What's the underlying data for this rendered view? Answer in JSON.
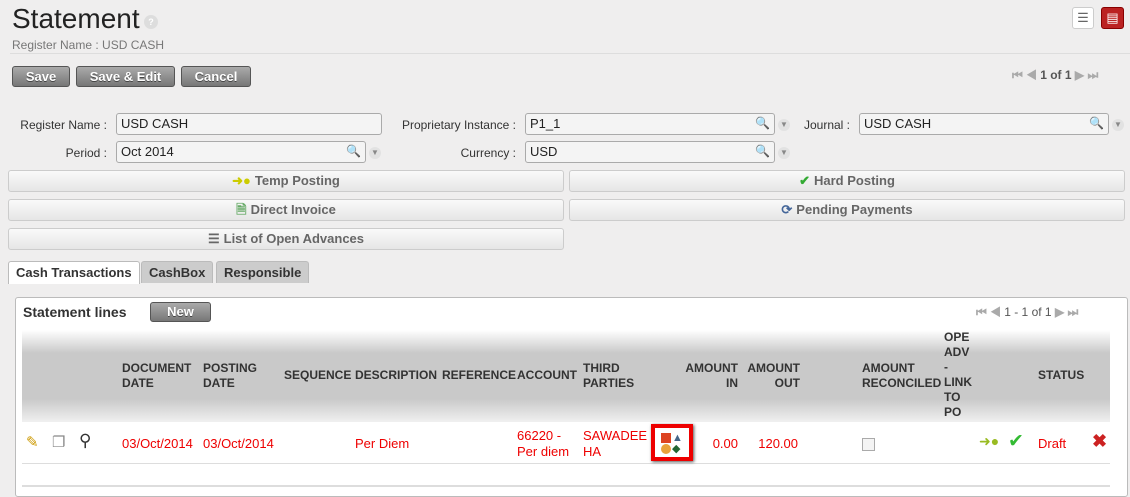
{
  "header": {
    "title": "Statement",
    "subtitle": "Register Name : USD CASH"
  },
  "toolbar": {
    "save": "Save",
    "save_edit": "Save & Edit",
    "cancel": "Cancel",
    "pager": "1 of 1"
  },
  "form": {
    "register_name_label": "Register Name :",
    "register_name": "USD CASH",
    "period_label": "Period :",
    "period": "Oct 2014",
    "proprietary_label": "Proprietary Instance :",
    "proprietary": "P1_1",
    "currency_label": "Currency :",
    "currency": "USD",
    "journal_label": "Journal :",
    "journal": "USD CASH"
  },
  "actions": {
    "temp_posting": "Temp Posting",
    "hard_posting": "Hard Posting",
    "direct_invoice": "Direct Invoice",
    "pending_payments": "Pending Payments",
    "open_advances": "List of Open Advances"
  },
  "tabs": [
    "Cash Transactions",
    "CashBox",
    "Responsible"
  ],
  "statement": {
    "title": "Statement lines",
    "new": "New",
    "pager": "1 - 1 of 1",
    "columns": {
      "doc_date": "DOCUMENT DATE",
      "posting_date": "POSTING DATE",
      "sequence": "SEQUENCE",
      "description": "DESCRIPTION",
      "reference": "REFERENCE",
      "account": "ACCOUNT",
      "third": "THIRD PARTIES",
      "amount_in": "AMOUNT IN",
      "amount_out": "AMOUNT OUT",
      "reconciled": "AMOUNT RECONCILED",
      "ope": "OPE ADV - LINK TO PO",
      "status": "STATUS"
    },
    "row": {
      "doc_date": "03/Oct/2014",
      "posting_date": "03/Oct/2014",
      "description": "Per Diem",
      "account": "66220 - Per diem",
      "third": "SAWADEE HA",
      "amount_in": "0.00",
      "amount_out": "120.00",
      "status": "Draft"
    }
  },
  "colors": {
    "red": "#e00000",
    "button": "#888888"
  }
}
